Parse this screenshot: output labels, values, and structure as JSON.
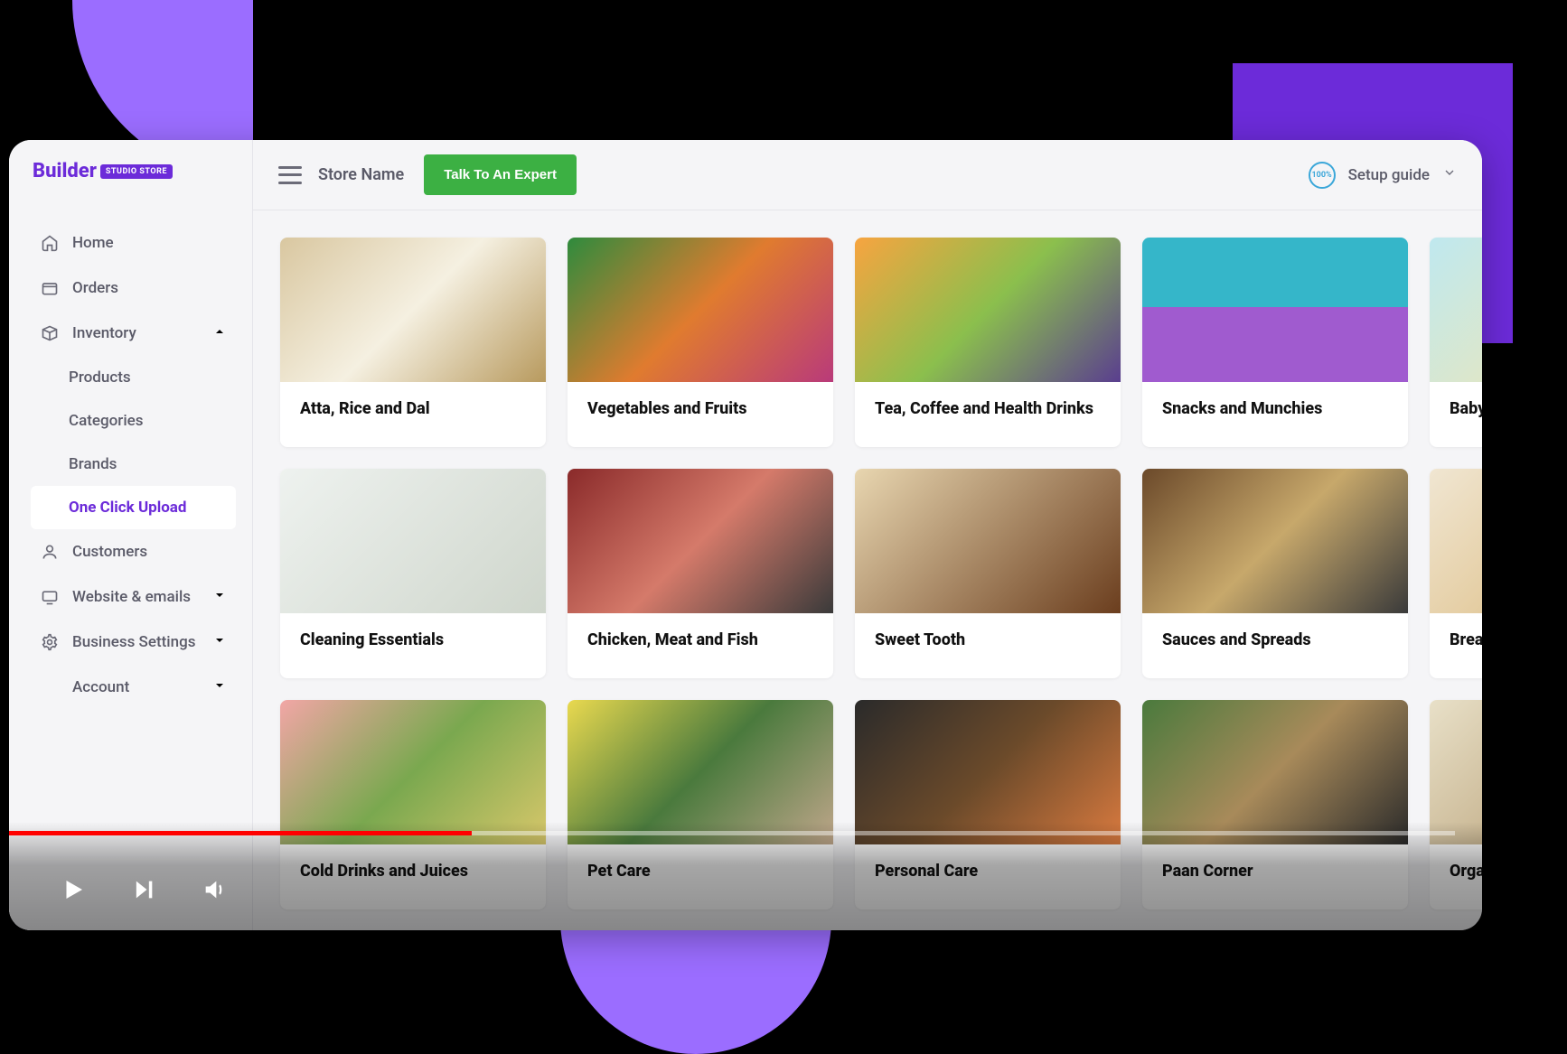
{
  "window": {
    "logo_text": "Builder",
    "logo_badge": "STUDIO STORE"
  },
  "topbar": {
    "store_name": "Store Name",
    "expert_button": "Talk To An Expert",
    "setup_guide": "Setup guide",
    "progress_pct": "100%"
  },
  "sidebar": {
    "items": [
      {
        "label": "Home",
        "icon": "home-icon"
      },
      {
        "label": "Orders",
        "icon": "orders-icon"
      },
      {
        "label": "Inventory",
        "icon": "inventory-icon",
        "expanded": true
      },
      {
        "label": "Customers",
        "icon": "customers-icon"
      },
      {
        "label": "Website & emails",
        "icon": "website-icon",
        "has_children": true
      },
      {
        "label": "Business Settings",
        "icon": "settings-icon",
        "has_children": true
      },
      {
        "label": "Account",
        "icon": "",
        "has_children": true
      }
    ],
    "inventory_sub": [
      {
        "label": "Products"
      },
      {
        "label": "Categories"
      },
      {
        "label": "Brands"
      },
      {
        "label": "One Click Upload",
        "active": true
      }
    ]
  },
  "categories": [
    {
      "title": "Atta, Rice and Dal",
      "img": "img-atta"
    },
    {
      "title": "Vegetables and Fruits",
      "img": "img-veg"
    },
    {
      "title": "Tea, Coffee and Health Drinks",
      "img": "img-tea"
    },
    {
      "title": "Snacks and Munchies",
      "img": "img-snack"
    },
    {
      "title": "Baby Care",
      "img": "img-baby"
    },
    {
      "title": "Cleaning Essentials",
      "img": "img-clean"
    },
    {
      "title": "Chicken, Meat and Fish",
      "img": "img-meat"
    },
    {
      "title": "Sweet Tooth",
      "img": "img-sweet"
    },
    {
      "title": "Sauces and Spreads",
      "img": "img-sauce"
    },
    {
      "title": "Breakfast",
      "img": "img-break"
    },
    {
      "title": "Cold Drinks and Juices",
      "img": "img-cold"
    },
    {
      "title": "Pet Care",
      "img": "img-pet"
    },
    {
      "title": "Personal Care",
      "img": "img-pers"
    },
    {
      "title": "Paan Corner",
      "img": "img-paan"
    },
    {
      "title": "Organic",
      "img": "img-org"
    }
  ],
  "video": {
    "progress_pct": 32
  },
  "colors": {
    "brand_purple": "#6c2bd9",
    "accent_purple": "#9b6dff",
    "green_cta": "#3cb043",
    "progress_red": "#ff0000"
  }
}
